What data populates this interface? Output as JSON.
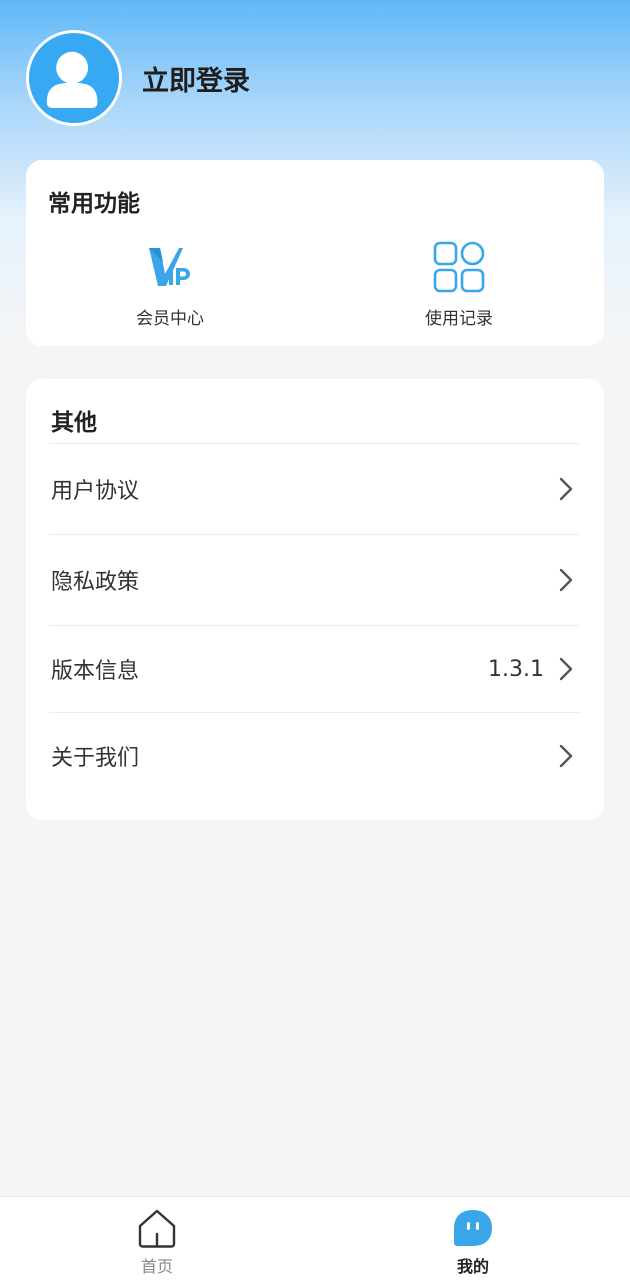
{
  "profile": {
    "login_text": "立即登录"
  },
  "common": {
    "title": "常用功能",
    "items": [
      {
        "label": "会员中心",
        "icon": "vip-icon"
      },
      {
        "label": "使用记录",
        "icon": "grid-icon"
      }
    ]
  },
  "other": {
    "title": "其他",
    "items": [
      {
        "label": "用户协议",
        "value": ""
      },
      {
        "label": "隐私政策",
        "value": ""
      },
      {
        "label": "版本信息",
        "value": "1.3.1"
      },
      {
        "label": "关于我们",
        "value": ""
      }
    ]
  },
  "tabbar": {
    "items": [
      {
        "label": "首页",
        "icon": "home-icon",
        "active": false
      },
      {
        "label": "我的",
        "icon": "mine-icon",
        "active": true
      }
    ]
  },
  "colors": {
    "accent": "#37a8f2",
    "background": "#f4f5f7"
  }
}
